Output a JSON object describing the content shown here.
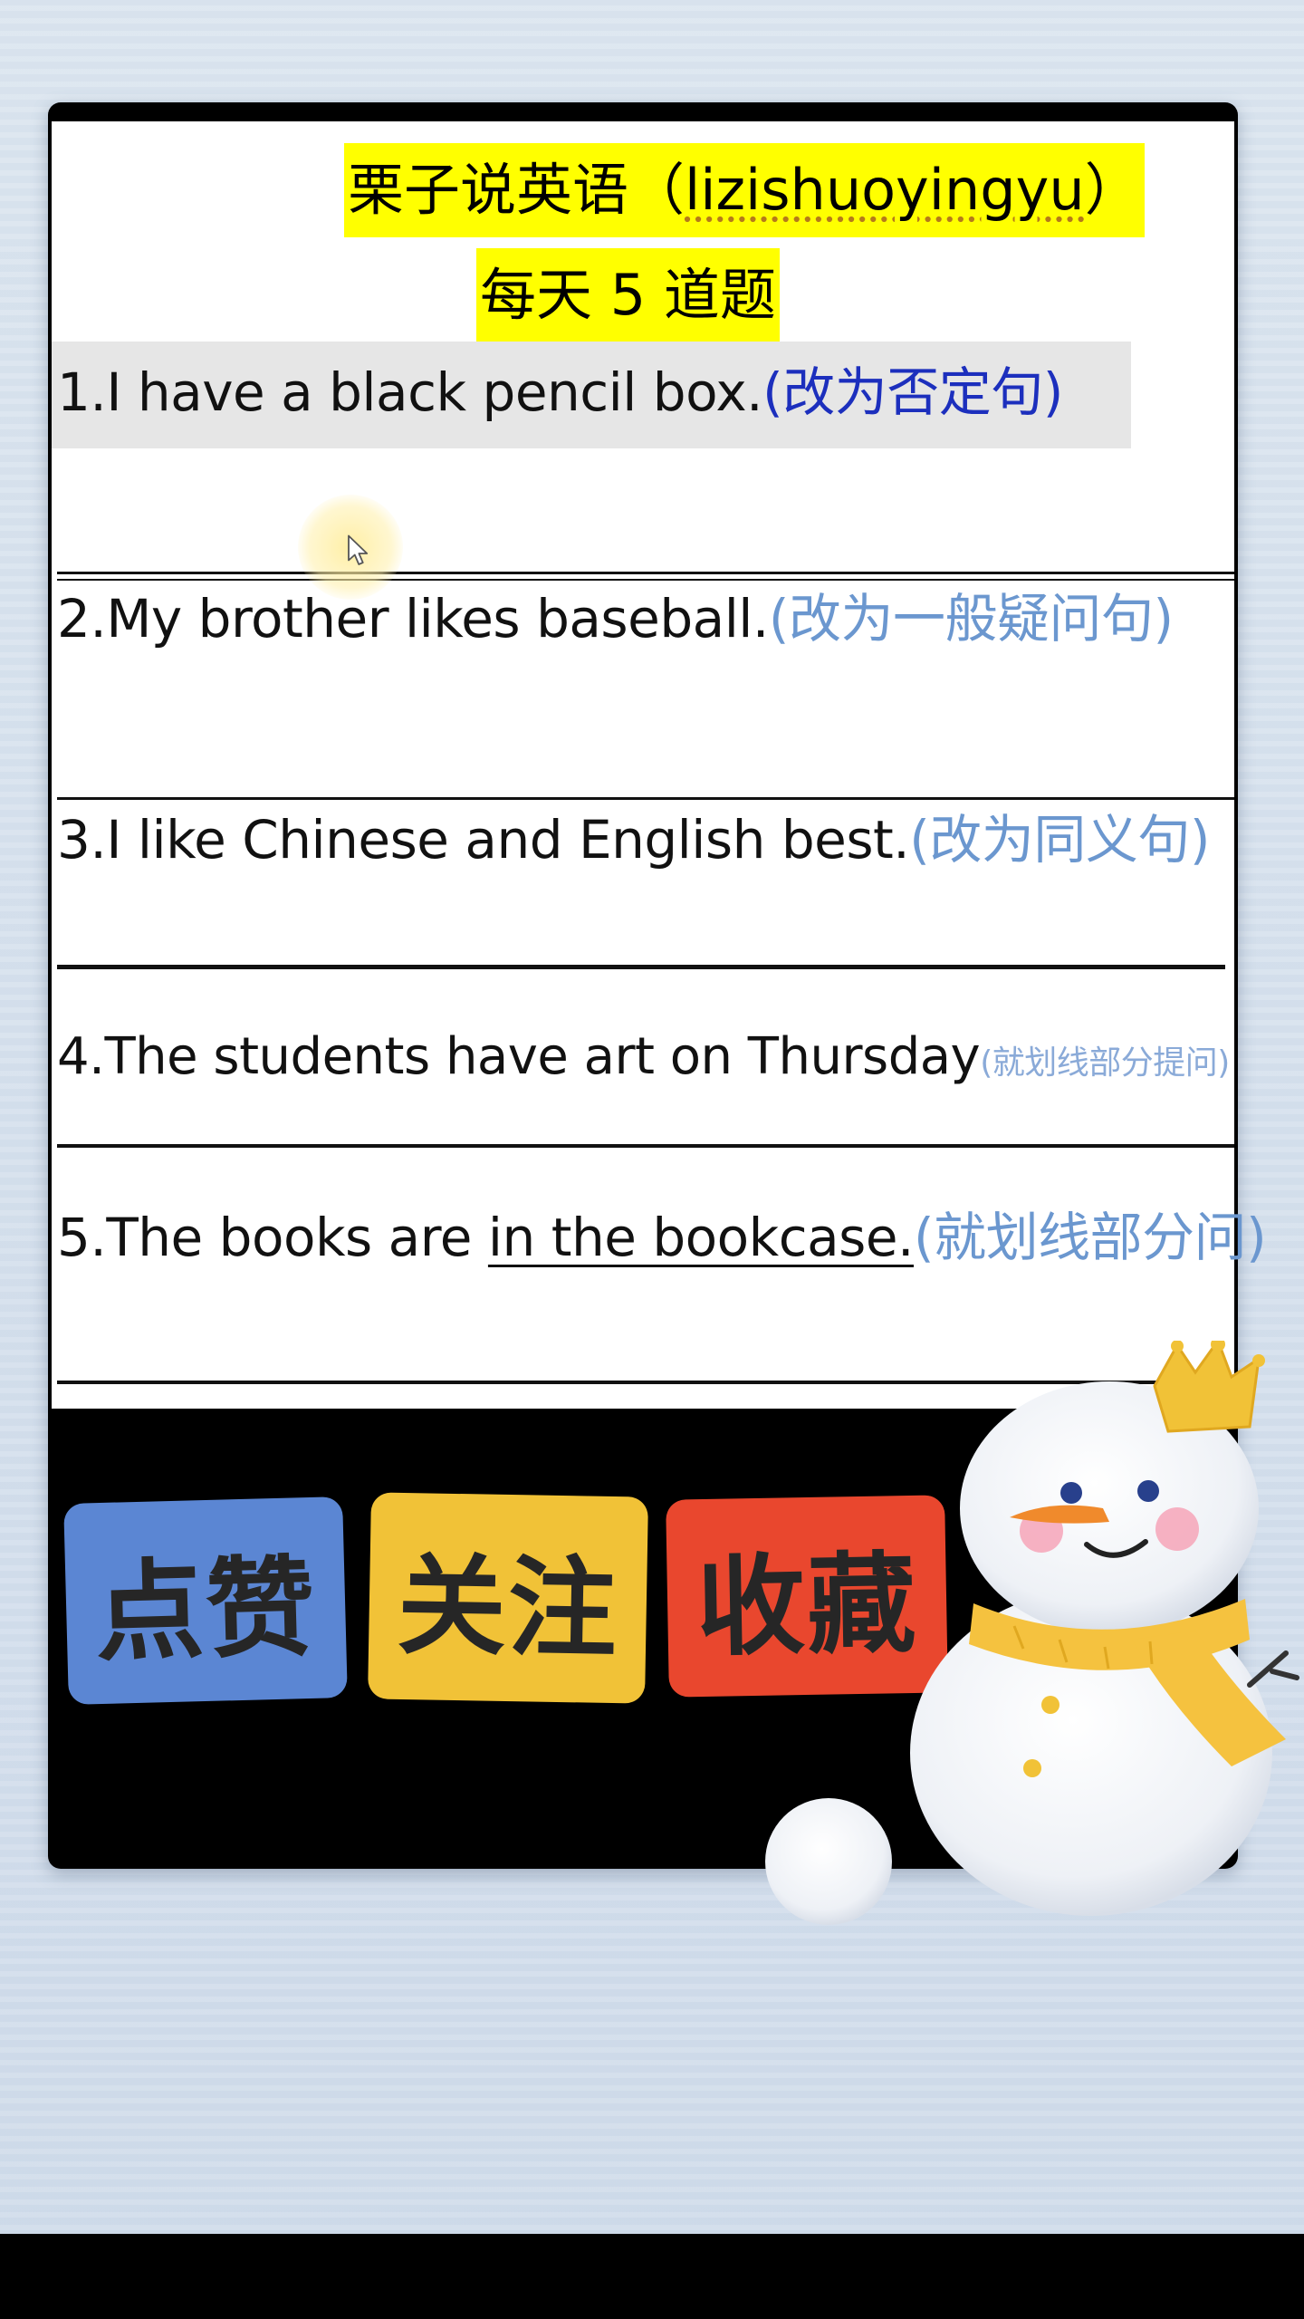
{
  "header": {
    "title_cn": "栗子说英语（",
    "title_handle": "lizishuoyingyu",
    "title_end": "）",
    "subtitle": "每天 5 道题"
  },
  "questions": [
    {
      "number": "1.",
      "text": "I have a black pencil box.",
      "instruction": "(改为否定句)"
    },
    {
      "number": "2.",
      "text": "My brother likes baseball.",
      "instruction": "(改为一般疑问句)"
    },
    {
      "number": "3.",
      "text": "I like Chinese and English best.",
      "instruction": "(改为同义句)"
    },
    {
      "number": "4.",
      "text": "The students have art on Thursday",
      "instruction": "(就划线部分提问)"
    },
    {
      "number": "5.",
      "text_before": "The books are ",
      "text_underlined": "in the bookcase.",
      "instruction": "(就划线部分问)"
    }
  ],
  "actions": {
    "like_label": "点赞",
    "follow_label": "关注",
    "collect_label": "收藏"
  },
  "colors": {
    "highlight": "#ffff00",
    "instruction_blue": "#6b97cf",
    "instruction_dark_blue": "#1c2fbd",
    "like_bg": "#5b86d3",
    "follow_bg": "#f1c237",
    "collect_bg": "#e9472e"
  }
}
